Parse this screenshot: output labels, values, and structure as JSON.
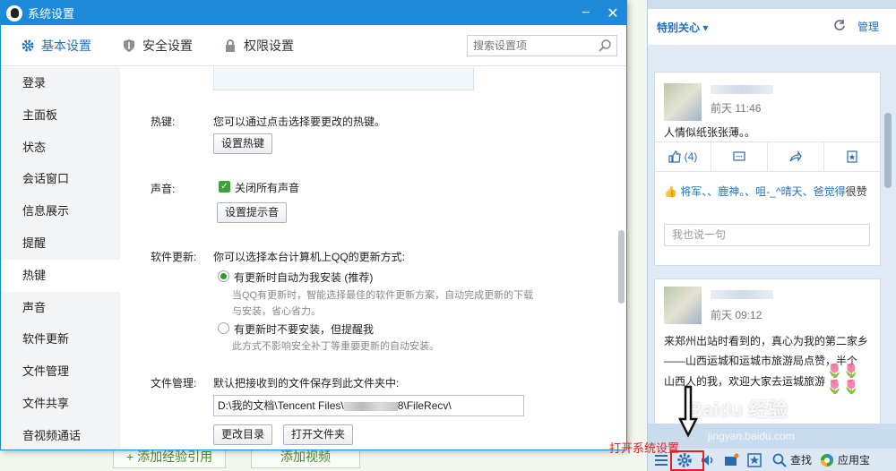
{
  "window": {
    "title": "系统设置",
    "min_label": "−",
    "close_label": "✕"
  },
  "tabs": [
    {
      "label": "基本设置",
      "icon": "gear-icon"
    },
    {
      "label": "安全设置",
      "icon": "shield-icon"
    },
    {
      "label": "权限设置",
      "icon": "lock-icon"
    }
  ],
  "search": {
    "placeholder": "搜索设置项"
  },
  "sidebar": {
    "items": [
      "登录",
      "主面板",
      "状态",
      "会话窗口",
      "信息展示",
      "提醒",
      "热键",
      "声音",
      "软件更新",
      "文件管理",
      "文件共享",
      "音视频通话"
    ],
    "active": "热键"
  },
  "hotkey": {
    "label": "热键:",
    "desc": "您可以通过点击选择要更改的热键。",
    "button": "设置热键"
  },
  "sound": {
    "label": "声音:",
    "checkbox": "关闭所有声音",
    "checked": true,
    "button": "设置提示音"
  },
  "update": {
    "label": "软件更新:",
    "desc": "你可以选择本台计算机上QQ的更新方式:",
    "option1": "有更新时自动为我安装 (推荐)",
    "option1_sub1": "当QQ有更新时，智能选择最佳的软件更新方案，自动完成更新的下载",
    "option1_sub2": "与安装，省心省力。",
    "option2": "有更新时不要安装，但提醒我",
    "option2_sub": "此方式不影响安全补丁等重要更新的自动安装。",
    "selected": 1
  },
  "files": {
    "label": "文件管理:",
    "desc": "默认把接收到的文件保存到此文件夹中:",
    "path_prefix": "D:\\我的文档\\Tencent Files\\",
    "path_suffix": "8\\FileRecv\\",
    "change_btn": "更改目录",
    "open_btn": "打开文件夹"
  },
  "background": {
    "btn1": "+ 添加经验引用",
    "btn2": "添加视频"
  },
  "qq_panel": {
    "header_title": "特别关心 ▾",
    "manage": "管理",
    "post1": {
      "time": "前天 11:46",
      "text": "人情似纸张张薄。。",
      "likes": "(4)",
      "like_names": "将军、、鹿神。、咀-_^晴天、爸觉得",
      "like_suffix": "很赞",
      "comment_placeholder": "我也说一句"
    },
    "post2": {
      "time": "前天 09:12",
      "line1": "来郑州出站时看到的，真心为我的第二家乡",
      "line2": "——山西运城和运城市旅游局点赞，半个",
      "line3": "山西人的我，欢迎大家去运城旅游"
    },
    "tray_find": "查找",
    "tray_app": "应用宝"
  },
  "annotation": "打开系统设置",
  "watermark": "Baidu 经验",
  "watermark_url": "jingyan.baidu.com",
  "colors": {
    "accent": "#1d8ad9",
    "highlight": "#e22222",
    "check": "#3aa33a"
  }
}
